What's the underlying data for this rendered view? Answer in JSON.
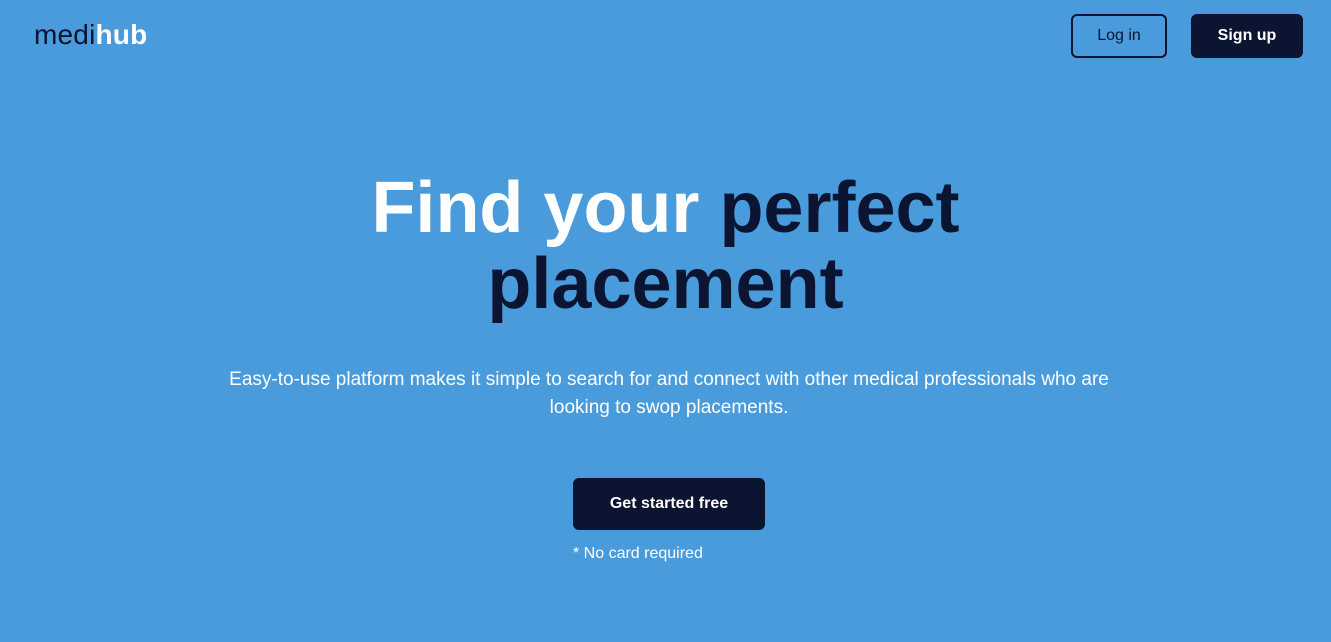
{
  "header": {
    "logo_light": "medi",
    "logo_bold": "hub",
    "login_label": "Log in",
    "signup_label": "Sign up"
  },
  "hero": {
    "title_white": "Find your ",
    "title_dark_1": "perfect",
    "title_dark_2": "placement",
    "subtitle": "Easy-to-use platform makes it simple to search for and connect with other medical professionals who are looking to swop placements.",
    "cta_label": "Get started free",
    "note": "* No card required"
  },
  "colors": {
    "background": "#4a9bdb",
    "navy": "#0b1431",
    "white": "#ffffff"
  }
}
